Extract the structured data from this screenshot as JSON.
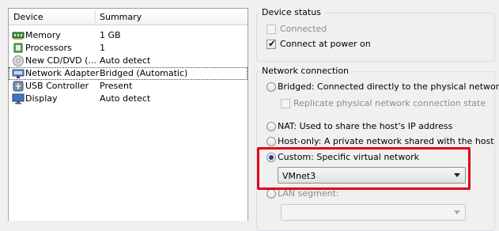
{
  "device_list": {
    "columns": [
      "Device",
      "Summary"
    ],
    "rows": [
      {
        "name": "Memory",
        "summary": "1 GB",
        "icon": "memory-icon"
      },
      {
        "name": "Processors",
        "summary": "1",
        "icon": "processor-icon"
      },
      {
        "name": "New CD/DVD (...",
        "summary": "Auto detect",
        "icon": "cd-dvd-icon"
      },
      {
        "name": "Network Adapter",
        "summary": "Bridged (Automatic)",
        "icon": "network-adapter-icon"
      },
      {
        "name": "USB Controller",
        "summary": "Present",
        "icon": "usb-icon"
      },
      {
        "name": "Display",
        "summary": "Auto detect",
        "icon": "display-icon"
      }
    ],
    "selected_row": "Network Adapter"
  },
  "device_status": {
    "title": "Device status",
    "connected_label": "Connected",
    "connected_checked": false,
    "connected_enabled": false,
    "connect_power_label": "Connect at power on",
    "connect_power_checked": true
  },
  "network_connection": {
    "title": "Network connection",
    "bridged_label": "Bridged: Connected directly to the physical network",
    "replicate_label": "Replicate physical network connection state",
    "nat_label": "NAT: Used to share the host's IP address",
    "hostonly_label": "Host-only: A private network shared with the host",
    "custom_label": "Custom: Specific virtual network",
    "custom_value": "VMnet3",
    "lan_label": "LAN segment:",
    "lan_value": "",
    "selected_option": "Custom"
  },
  "colors": {
    "highlight_box": "#e0001b",
    "radio_dot": "#1e3f8f"
  }
}
